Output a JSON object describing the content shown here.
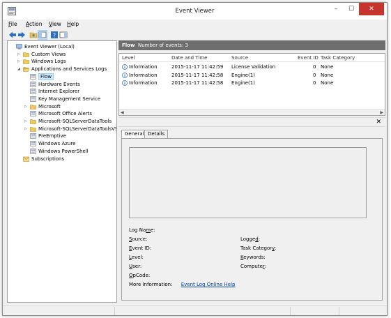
{
  "window": {
    "title": "Event Viewer",
    "minimize": "–",
    "maximize": "☐",
    "close": "✕"
  },
  "menu": [
    {
      "pre": "",
      "ul": "F",
      "post": "ile"
    },
    {
      "pre": "",
      "ul": "A",
      "post": "ction"
    },
    {
      "pre": "",
      "ul": "V",
      "post": "iew"
    },
    {
      "pre": "",
      "ul": "H",
      "post": "elp"
    }
  ],
  "tree": {
    "items": [
      {
        "label": "Event Viewer (Local)",
        "arrow": "",
        "icon": "computer-icon"
      },
      {
        "label": "Custom Views",
        "arrow": "▷",
        "icon": "folder-icon"
      },
      {
        "label": "Windows Logs",
        "arrow": "▷",
        "icon": "folder-icon"
      },
      {
        "label": "Applications and Services Logs",
        "arrow": "◢",
        "icon": "folder-open-icon"
      },
      {
        "label": "Flow",
        "arrow": "",
        "icon": "log-icon",
        "selected": true
      },
      {
        "label": "Hardware Events",
        "arrow": "",
        "icon": "log-icon"
      },
      {
        "label": "Internet Explorer",
        "arrow": "",
        "icon": "log-icon"
      },
      {
        "label": "Key Management Service",
        "arrow": "",
        "icon": "log-icon"
      },
      {
        "label": "Microsoft",
        "arrow": "▷",
        "icon": "folder-icon"
      },
      {
        "label": "Microsoft Office Alerts",
        "arrow": "",
        "icon": "log-icon"
      },
      {
        "label": "Microsoft-SQLServerDataTools",
        "arrow": "▷",
        "icon": "folder-icon"
      },
      {
        "label": "Microsoft-SQLServerDataToolsVS",
        "arrow": "▷",
        "icon": "folder-icon"
      },
      {
        "label": "PreEmptive",
        "arrow": "",
        "icon": "log-icon"
      },
      {
        "label": "Windows Azure",
        "arrow": "",
        "icon": "log-icon"
      },
      {
        "label": "Windows PowerShell",
        "arrow": "",
        "icon": "log-icon"
      },
      {
        "label": "Subscriptions",
        "arrow": "",
        "icon": "subscriptions-icon"
      }
    ]
  },
  "log": {
    "name": "Flow",
    "count_text": "Number of events: 3",
    "columns": [
      "Level",
      "Date and Time",
      "Source",
      "Event ID",
      "Task Category"
    ],
    "rows": [
      {
        "level": "Information",
        "date": "2015-11-17 11:42:59",
        "source": "License Validation",
        "event_id": "0",
        "task": "None"
      },
      {
        "level": "Information",
        "date": "2015-11-17 11:42:58",
        "source": "Engine(1)",
        "event_id": "0",
        "task": "None"
      },
      {
        "level": "Information",
        "date": "2015-11-17 11:42:58",
        "source": "Engine(1)",
        "event_id": "0",
        "task": "None"
      }
    ]
  },
  "details": {
    "close_glyph": "✕",
    "tabs": [
      "General",
      "Details"
    ],
    "fields_left": [
      {
        "pre": "Log Na",
        "ul": "m",
        "post": "e:"
      },
      {
        "pre": "",
        "ul": "S",
        "post": "ource:"
      },
      {
        "pre": "",
        "ul": "E",
        "post": "vent ID:"
      },
      {
        "pre": "",
        "ul": "L",
        "post": "evel:"
      },
      {
        "pre": "",
        "ul": "U",
        "post": "ser:"
      },
      {
        "pre": "",
        "ul": "O",
        "post": "pCode:"
      }
    ],
    "more_info_label": "More Information:",
    "more_info_link": "Event Log Online Help",
    "fields_right": [
      {
        "pre": "Logge",
        "ul": "d",
        "post": ":"
      },
      {
        "pre": "Task Categor",
        "ul": "y",
        "post": ":"
      },
      {
        "pre": "",
        "ul": "K",
        "post": "eywords:"
      },
      {
        "pre": "Compute",
        "ul": "r",
        "post": ":"
      }
    ]
  },
  "colors": {
    "header_bg": "#6e6e6e",
    "selection": "#cce8ff",
    "link": "#0645ad",
    "close_btn": "#c7342e"
  }
}
